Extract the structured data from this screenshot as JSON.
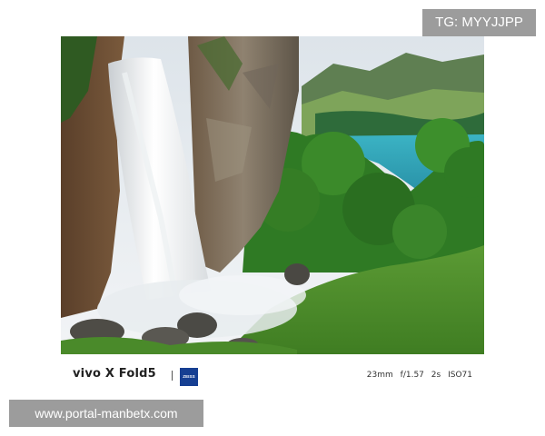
{
  "watermark_top": {
    "text": "TG: MYYJJPP"
  },
  "watermark_bottom": {
    "text": "www.portal-manbetx.com"
  },
  "photo": {
    "subject": "waterfall-cliff-lake-landscape"
  },
  "camera_info": {
    "brand": "vivo X Fold5",
    "lens_logo_text": "ZEISS",
    "focal_length": "23mm",
    "aperture": "f/1.57",
    "shutter": "2s",
    "iso": "ISO71"
  },
  "colors": {
    "badge_bg": "#9c9c9c",
    "zeiss_blue": "#163f92",
    "lake": "#2fa3b5",
    "foliage": "#3f8a2a"
  }
}
